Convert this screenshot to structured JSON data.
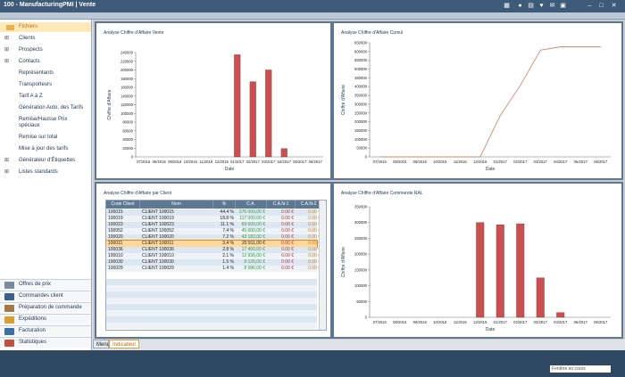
{
  "window": {
    "title": "100 - ManufacturingPMI | Vente"
  },
  "sidebar": {
    "items": [
      {
        "label": "Fichiers",
        "expand": "",
        "selected": true
      },
      {
        "label": "Clients",
        "expand": "⊞"
      },
      {
        "label": "Prospects",
        "expand": "⊞"
      },
      {
        "label": "Contacts",
        "expand": "⊞"
      },
      {
        "label": "Représentants",
        "expand": ""
      },
      {
        "label": "Transporteurs",
        "expand": ""
      },
      {
        "label": "Tarif A à Z",
        "expand": ""
      },
      {
        "label": "Génération Auto. des Tarifs",
        "expand": ""
      },
      {
        "label": "Remise/Hausse Prix spéciaux",
        "expand": ""
      },
      {
        "label": "Remise sur total",
        "expand": ""
      },
      {
        "label": "Mise à jour des tarifs",
        "expand": ""
      },
      {
        "label": "Générateur d'Étiquettes",
        "expand": "⊞"
      },
      {
        "label": "Listes standards",
        "expand": "⊞"
      }
    ],
    "modules": [
      {
        "label": "Offres de prix",
        "icon": "eye-icon",
        "color": "#7a8b9c"
      },
      {
        "label": "Commandes client",
        "icon": "document-icon",
        "color": "#3a5f8a"
      },
      {
        "label": "Préparation de commande",
        "icon": "box-icon",
        "color": "#a0784a"
      },
      {
        "label": "Expéditions",
        "icon": "truck-icon",
        "color": "#d9a030"
      },
      {
        "label": "Facturation",
        "icon": "invoice-icon",
        "color": "#3a6fa8"
      },
      {
        "label": "Statistiques",
        "icon": "chart-icon",
        "color": "#c05040"
      }
    ]
  },
  "tabs": {
    "menu": "Menu",
    "indicateur": "Indicateur"
  },
  "panels": {
    "p1": {
      "title": "Analyse Chiffre d'Affaire Vente"
    },
    "p2": {
      "title": "Analyse Chiffre d'Affaire Cumul"
    },
    "p3": {
      "title": "Analyse Chiffre d'Affaire par Client"
    },
    "p4": {
      "title": "Analyse Chiffre d'Affaire Commande RAL"
    }
  },
  "grid": {
    "headers": [
      "Code Client",
      "Nom",
      "%",
      "C.A.",
      "C.A.N-1",
      "C.A.N-2"
    ],
    "rows": [
      [
        "100015",
        "CLIENT 100015",
        "44.4 %",
        "270 000,00 €",
        "0.00 €",
        "0.00 €"
      ],
      [
        "100019",
        "CLIENT 100019",
        "18.8 %",
        "117 000,00 €",
        "0.00 €",
        "0.00 €"
      ],
      [
        "100023",
        "CLIENT 100023",
        "11.1 %",
        "69 000,00 €",
        "0.00 €",
        "0.00 €"
      ],
      [
        "100052",
        "CLIENT 100052",
        "7.4 %",
        "45 000,00 €",
        "0.00 €",
        "0.00 €"
      ],
      [
        "100020",
        "CLIENT 100020",
        "7.2 %",
        "43 182,00 €",
        "0.00 €",
        "0.00 €"
      ],
      [
        "100011",
        "CLIENT 100011",
        "3.4 %",
        "20 911,00 €",
        "0.00 €",
        "0.00 €"
      ],
      [
        "100036",
        "CLIENT 100036",
        "2.8 %",
        "17 400,00 €",
        "0.00 €",
        "0.00 €"
      ],
      [
        "100010",
        "CLIENT 100010",
        "2.1 %",
        "12 936,00 €",
        "0.00 €",
        "0.00 €"
      ],
      [
        "100030",
        "CLIENT 100030",
        "1.5 %",
        "9 126,00 €",
        "0.00 €",
        "0.00 €"
      ],
      [
        "100029",
        "CLIENT 100029",
        "1.4 %",
        "8 586,00 €",
        "0.00 €",
        "0.00 €"
      ]
    ],
    "selected_row": 5
  },
  "status": {
    "selector": "Fenêtre en cours"
  },
  "colors": {
    "accent": "#c86a00",
    "bar": "#c95050",
    "line": "#d08a70",
    "header": "#5d7893"
  },
  "chart_data": [
    {
      "type": "bar",
      "title": "Analyse Chiffre d'Affaire Vente",
      "xlabel": "Date",
      "ylabel": "Chiffre d'Affaire",
      "categories": [
        "07/2016",
        "08/2016",
        "09/2016",
        "10/2016",
        "11/2016",
        "12/2016",
        "01/2017",
        "02/2017",
        "03/2017",
        "04/2017",
        "05/2017",
        "06/2017"
      ],
      "values": [
        0,
        0,
        0,
        0,
        0,
        0,
        235000,
        173000,
        200000,
        19000,
        0,
        0
      ],
      "ylim": [
        0,
        240000
      ],
      "yticks": [
        "0",
        "20000",
        "40000",
        "60000",
        "80000",
        "100000",
        "120000",
        "140000",
        "160000",
        "180000",
        "200000",
        "220000",
        "240000"
      ]
    },
    {
      "type": "line",
      "title": "Analyse Chiffre d'Affaire Cumul",
      "xlabel": "Date",
      "ylabel": "Chiffre d'Affaire",
      "categories": [
        "07/2016",
        "08/2016",
        "09/2016",
        "10/2016",
        "11/2016",
        "12/2016",
        "01/2017",
        "02/2017",
        "03/2017",
        "04/2017",
        "05/2017",
        "06/2017"
      ],
      "values": [
        0,
        0,
        0,
        0,
        0,
        0,
        235000,
        408000,
        608000,
        627000,
        627000,
        627000
      ],
      "ylim": [
        0,
        650000
      ],
      "yticks": [
        "0",
        "50000",
        "100000",
        "150000",
        "200000",
        "250000",
        "300000",
        "350000",
        "400000",
        "450000",
        "500000",
        "550000",
        "600000",
        "650000"
      ]
    },
    {
      "type": "bar",
      "title": "Analyse Chiffre d'Affaire Commande RAL",
      "xlabel": "Date",
      "ylabel": "Chiffre d'Affaire",
      "categories": [
        "07/2016",
        "08/2016",
        "09/2016",
        "10/2016",
        "11/2016",
        "12/2016",
        "01/2017",
        "02/2017",
        "03/2017",
        "04/2017",
        "05/2017",
        "06/2017"
      ],
      "values": [
        0,
        0,
        0,
        0,
        0,
        300000,
        293000,
        296000,
        125000,
        15000,
        0,
        0
      ],
      "ylim": [
        0,
        350000
      ],
      "yticks": [
        "0",
        "50000",
        "100000",
        "150000",
        "200000",
        "250000",
        "300000",
        "350000"
      ]
    }
  ]
}
